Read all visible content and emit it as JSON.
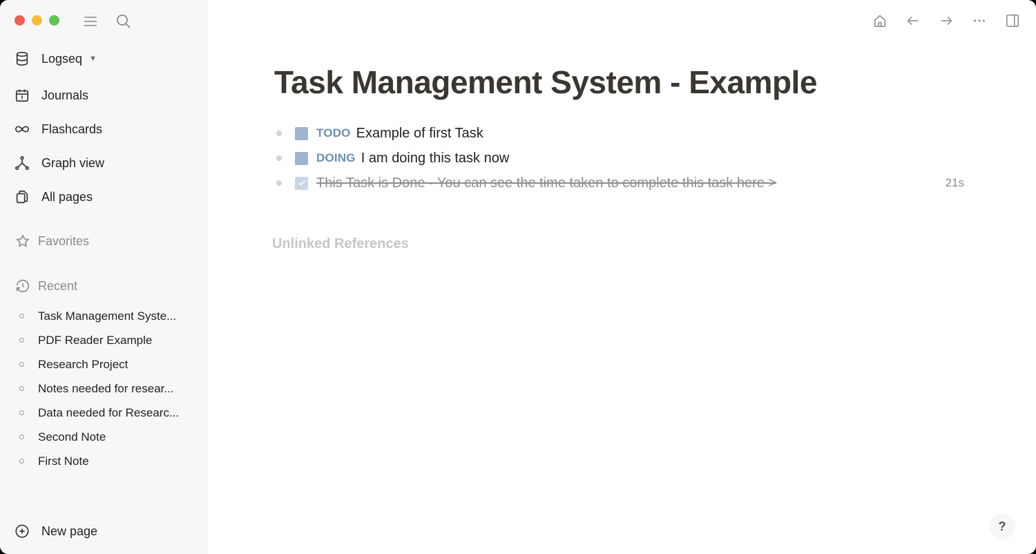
{
  "sidebar": {
    "graph_name": "Logseq",
    "nav": [
      {
        "label": "Journals",
        "icon": "calendar-icon"
      },
      {
        "label": "Flashcards",
        "icon": "infinity-icon"
      },
      {
        "label": "Graph view",
        "icon": "graph-icon"
      },
      {
        "label": "All pages",
        "icon": "pages-icon"
      }
    ],
    "favorites_label": "Favorites",
    "recent_label": "Recent",
    "recent": [
      "Task Management Syste...",
      "PDF Reader Example",
      "Research Project",
      "Notes needed for resear...",
      "Data needed for Researc...",
      "Second Note",
      "First Note"
    ],
    "new_page_label": "New page"
  },
  "page": {
    "title": "Task Management System - Example",
    "blocks": [
      {
        "marker": "TODO",
        "text": "Example of first Task",
        "done": false
      },
      {
        "marker": "DOING",
        "text": "I am doing this task now",
        "done": false
      },
      {
        "marker": "DONE",
        "text": "This Task is Done - You can see the time taken to complete this task here >",
        "done": true,
        "elapsed": "21s"
      }
    ],
    "unlinked_references": "Unlinked References"
  },
  "help": {
    "label": "?"
  },
  "colors": {
    "marker": "#6e8eae",
    "checkbox": "#9fb4cf",
    "title": "#3a3631"
  }
}
